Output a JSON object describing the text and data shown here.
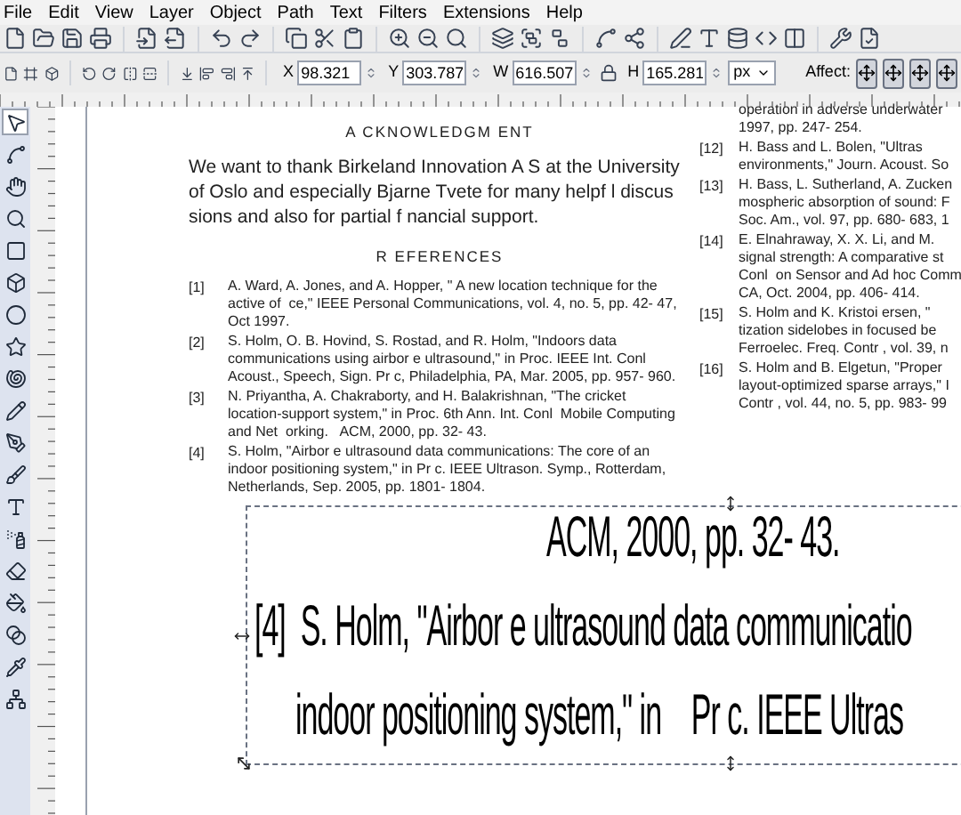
{
  "menu": [
    "File",
    "Edit",
    "View",
    "Layer",
    "Object",
    "Path",
    "Text",
    "Filters",
    "Extensions",
    "Help"
  ],
  "toolbar_fields": [
    {
      "label": "X",
      "value": "98.321"
    },
    {
      "label": "Y",
      "value": "303.787"
    },
    {
      "label": "W",
      "value": "616.507"
    },
    {
      "label": "H",
      "value": "165.281"
    }
  ],
  "unit": "px",
  "affect": {
    "label": "Affect:",
    "buttons": [
      {
        "selected": true
      },
      {
        "selected": true
      },
      {
        "selected": true
      },
      {
        "selected": true
      }
    ]
  },
  "tools": [
    {
      "selected": true
    },
    {
      "selected": false
    },
    {
      "selected": false
    },
    {
      "selected": false
    },
    {
      "selected": false
    },
    {
      "selected": false
    },
    {
      "selected": false
    },
    {
      "selected": false
    },
    {
      "selected": false
    },
    {
      "selected": false
    },
    {
      "selected": false
    },
    {
      "selected": false
    },
    {
      "selected": false
    },
    {
      "selected": false
    },
    {
      "selected": false
    },
    {
      "selected": false
    },
    {
      "selected": false
    },
    {
      "selected": false
    },
    {
      "selected": false
    }
  ],
  "document": {
    "acknowledgment_heading": "A CKNOWLEDGM ENT",
    "acknowledgment_lines": [
      "We want to thank Birkeland Innovation A S at the University",
      "of Oslo and especially Bjarne Tvete for many helpf l discus",
      "sions and also for partial f nancial support."
    ],
    "references_heading": "R EFERENCES",
    "references_left": [
      {
        "number": "[1]",
        "lines": [
          "A. Ward, A. Jones, and A. Hopper, \" A new location technique for the",
          "active of  ce,\" IEEE Personal Communications, vol. 4, no. 5, pp. 42- 47,",
          "Oct 1997."
        ]
      },
      {
        "number": "[2]",
        "lines": [
          "S. Holm, O. B. Hovind, S. Rostad, and R. Holm, \"Indoors data",
          "communications using airbor e ultrasound,\" in Proc. IEEE Int. Conl",
          "Acoust., Speech, Sign. Pr c, Philadelphia, PA, Mar. 2005, pp. 957- 960."
        ]
      },
      {
        "number": "[3]",
        "lines": [
          "N. Priyantha, A. Chakraborty, and H. Balakrishnan, \"The cricket",
          "location-support system,\" in Proc. 6th Ann. Int. Conl  Mobile Computing",
          "and Net  orking.   ACM, 2000, pp. 32- 43."
        ]
      },
      {
        "number": "[4]",
        "lines": [
          "S. Holm, \"Airbor e ultrasound data communications: The core of an",
          "indoor positioning system,\" in Pr c. IEEE Ultrason. Symp., Rotterdam,",
          "Netherlands, Sep. 2005, pp. 1801- 1804."
        ]
      }
    ],
    "references_right": [
      {
        "lines": [
          "operation in adverse underwater",
          "1997, pp. 247- 254."
        ]
      },
      {
        "number": "[12]",
        "lines": [
          "H. Bass and L. Bolen, \"Ultras",
          "environments,\" Journ. Acoust. So"
        ]
      },
      {
        "number": "[13]",
        "lines": [
          "H. Bass, L. Sutherland, A. Zucken",
          "mospheric absorption of sound: F",
          "Soc. Am., vol. 97, pp. 680- 683, 1"
        ]
      },
      {
        "number": "[14]",
        "lines": [
          "E. Elnahraway, X. X. Li, and M.",
          "signal strength: A comparative st",
          "Conl  on Sensor and Ad hoc Comm",
          "CA, Oct. 2004, pp. 406- 414."
        ]
      },
      {
        "number": "[15]",
        "lines": [
          "S. Holm and K. Kristoi ersen, \"",
          "tization sidelobes in focused be",
          "Ferroelec. Freq. Contr , vol. 39, n"
        ]
      },
      {
        "number": "[16]",
        "lines": [
          "S. Holm and B. Elgetun, \"Proper",
          "layout-optimized sparse arrays,\" I",
          "Contr , vol. 44, no. 5, pp. 983- 99"
        ]
      }
    ],
    "zoomed_lines": [
      "ACM, 2000, pp. 32- 43.",
      "[4]  S. Holm, \"Airbor e ultrasound data communicatio",
      "indoor positioning system,\" in    Pr c. IEEE Ultras"
    ]
  }
}
